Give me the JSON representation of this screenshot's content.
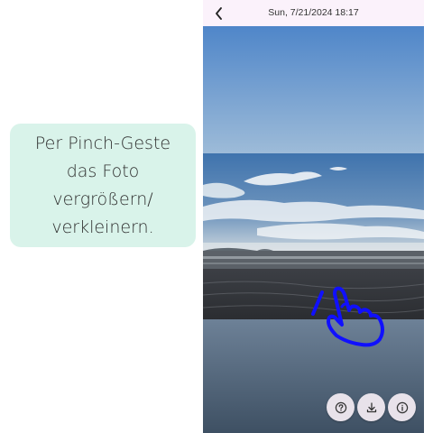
{
  "callout": {
    "text": "Per Pinch-Geste\ndas Foto\nvergrößern/\nverkleinern."
  },
  "topbar": {
    "title": "Sun, 7/21/2024  18:17",
    "back_icon": "chevron-left-icon"
  },
  "photo": {
    "subject": "beach-sunset-photo"
  },
  "actions": [
    {
      "icon": "help-icon"
    },
    {
      "icon": "download-icon"
    },
    {
      "icon": "info-icon"
    }
  ],
  "gesture": {
    "icon": "pinch-gesture-icon",
    "color": "#1010ff"
  },
  "colors": {
    "callout_bg": "#d9f3ea",
    "topbar_bg": "#fbf2fb",
    "fab_bg": "#e8e2ea"
  }
}
